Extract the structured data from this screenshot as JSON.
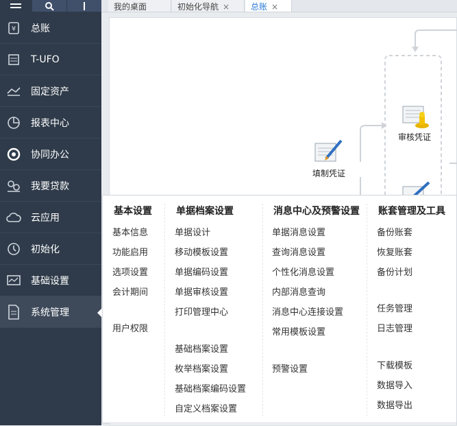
{
  "top_buttons": [
    {
      "icon": "hamburger-icon"
    },
    {
      "icon": "search-icon"
    },
    {
      "icon": "plus-icon"
    }
  ],
  "sidebar": {
    "items": [
      {
        "label": "总账",
        "icon": "ledger-icon"
      },
      {
        "label": "T-UFO",
        "icon": "ufo-report-icon"
      },
      {
        "label": "固定资产",
        "icon": "fixed-asset-icon"
      },
      {
        "label": "报表中心",
        "icon": "pie-chart-icon"
      },
      {
        "label": "协同办公",
        "icon": "collaboration-icon"
      },
      {
        "label": "我要贷款",
        "icon": "loan-icon"
      },
      {
        "label": "云应用",
        "icon": "cloud-icon"
      },
      {
        "label": "初始化",
        "icon": "init-clock-icon"
      },
      {
        "label": "基础设置",
        "icon": "basic-settings-icon"
      },
      {
        "label": "系统管理",
        "icon": "system-document-icon"
      }
    ],
    "active_label": "系统管理"
  },
  "tabs": [
    {
      "label": "我的桌面"
    },
    {
      "label": "初始化导航",
      "close": "×"
    },
    {
      "label": "总账",
      "close": "×"
    }
  ],
  "flow": {
    "review_voucher": "审核凭证",
    "fill_voucher": "填制凭证"
  },
  "menu": {
    "columns": [
      {
        "title": "基本设置",
        "items": [
          "基本信息",
          "功能启用",
          "选项设置",
          "会计期间",
          "用户权限"
        ]
      },
      {
        "title": "单据档案设置",
        "items": [
          "单据设计",
          "移动模板设置",
          "单据编码设置",
          "单据审核设置",
          "打印管理中心",
          "基础档案设置",
          "枚举档案设置",
          "基础档案编码设置",
          "自定义档案设置"
        ]
      },
      {
        "title": "消息中心及预警设置",
        "items": [
          "单据消息设置",
          "查询消息设置",
          "个性化消息设置",
          "内部消息查询",
          "消息中心连接设置",
          "常用模板设置",
          "预警设置"
        ]
      },
      {
        "title": "账套管理及工具",
        "items": [
          "备份账套",
          "恢复账套",
          "备份计划",
          "任务管理",
          "日志管理",
          "下载模板",
          "数据导入",
          "数据导出"
        ]
      }
    ]
  },
  "colors": {
    "sidebar_bg": "#2f3b4a",
    "active_tab": "#2a7bd4"
  }
}
